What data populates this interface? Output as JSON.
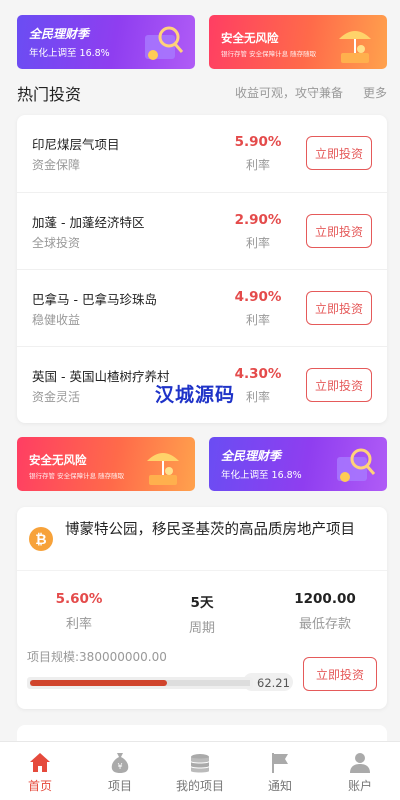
{
  "banners_top": [
    {
      "title": "全民理财季",
      "subtitle": "年化上调至 16.8%",
      "style": "purple"
    },
    {
      "title": "安全无风险",
      "subtitle": "银行存管 安全保障计息 随存随取",
      "style": "orange"
    }
  ],
  "banners_mid": [
    {
      "title": "安全无风险",
      "subtitle": "银行存管 安全保障计息 随存随取",
      "style": "orange"
    },
    {
      "title": "全民理财季",
      "subtitle": "年化上调至 16.8%",
      "style": "purple"
    }
  ],
  "hot_section": {
    "title": "热门投资",
    "tagline": "收益可观，攻守兼备",
    "more_label": "更多"
  },
  "investments": [
    {
      "name": "印尼煤层气项目",
      "tag": "资金保障",
      "rate": "5.90%",
      "rate_label": "利率",
      "button": "立即投资"
    },
    {
      "name": "加蓬 - 加蓬经济特区",
      "tag": "全球投资",
      "rate": "2.90%",
      "rate_label": "利率",
      "button": "立即投资"
    },
    {
      "name": "巴拿马 - 巴拿马珍珠岛",
      "tag": "稳健收益",
      "rate": "4.90%",
      "rate_label": "利率",
      "button": "立即投资"
    },
    {
      "name": "英国 - 英国山楂树疗养村",
      "tag": "资金灵活",
      "rate": "4.30%",
      "rate_label": "利率",
      "button": "立即投资"
    }
  ],
  "watermark": "汉城源码",
  "featured": {
    "icon_char": "₿",
    "title": "博蒙特公园，移民圣基茨的高品质房地产项目",
    "stats": [
      {
        "value": "5.60%",
        "label": "利率"
      },
      {
        "value": "5天",
        "label": "周期"
      },
      {
        "value": "1200.00",
        "label": "最低存款"
      }
    ],
    "scale_text": "项目规模:380000000.00",
    "progress_percent": 62.21,
    "progress_label": "62.21",
    "button": "立即投资"
  },
  "tabbar": [
    {
      "label": "首页",
      "icon": "home-icon",
      "active": true
    },
    {
      "label": "项目",
      "icon": "money-bag-icon",
      "active": false
    },
    {
      "label": "我的项目",
      "icon": "coin-stack-icon",
      "active": false
    },
    {
      "label": "通知",
      "icon": "flag-icon",
      "active": false
    },
    {
      "label": "账户",
      "icon": "user-icon",
      "active": false
    }
  ],
  "colors": {
    "accent_red": "#e44b4b",
    "button_border": "#e55a5a",
    "tab_active": "#e54a3c",
    "banner_purple": "#7b45f1",
    "banner_orange": "#ff5a55",
    "progress_fill": "#d0442c"
  }
}
